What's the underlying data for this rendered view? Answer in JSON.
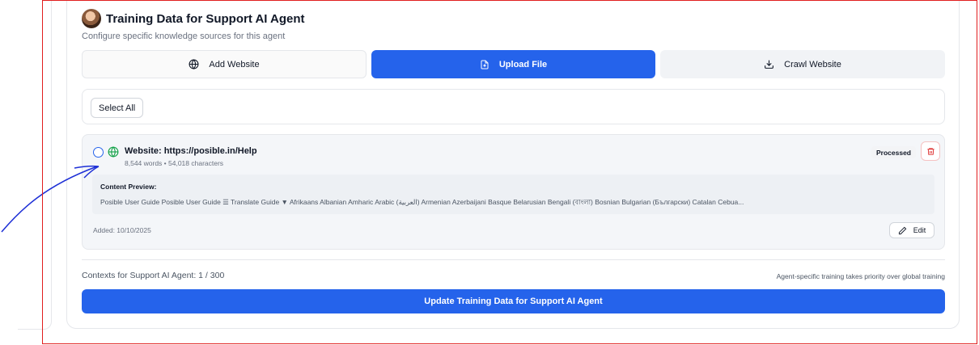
{
  "header": {
    "title": "Training Data for Support AI Agent",
    "subtitle": "Configure specific knowledge sources for this agent"
  },
  "tabs": [
    {
      "label": "Add Website",
      "icon": "globe-icon",
      "active": false
    },
    {
      "label": "Upload File",
      "icon": "file-upload-icon",
      "active": true
    },
    {
      "label": "Crawl Website",
      "icon": "download-icon",
      "active": false
    }
  ],
  "select_all_label": "Select All",
  "item": {
    "title": "Website: https://posible.in/Help",
    "meta": "8,544 words • 54,018 characters",
    "status": "Processed",
    "preview_label": "Content Preview:",
    "preview_text": "Posible User Guide Posible User Guide ☰ Translate Guide ▼ Afrikaans Albanian Amharic Arabic (العربية) Armenian Azerbaijani Basque Belarusian Bengali (বাংলা) Bosnian Bulgarian (Български) Catalan Cebua...",
    "added": "Added: 10/10/2025",
    "edit_label": "Edit"
  },
  "footer": {
    "contexts": "Contexts for Support AI Agent: 1 / 300",
    "priority_note": "Agent-specific training takes priority over global training",
    "update_label": "Update Training Data for Support AI Agent"
  },
  "colors": {
    "primary": "#2563eb",
    "processed_bg": "#f3f4f6",
    "delete": "#dc2626",
    "globe_green": "#16a34a",
    "annotation_border": "#e11d1d",
    "annotation_arrow": "#1d2fd6"
  }
}
